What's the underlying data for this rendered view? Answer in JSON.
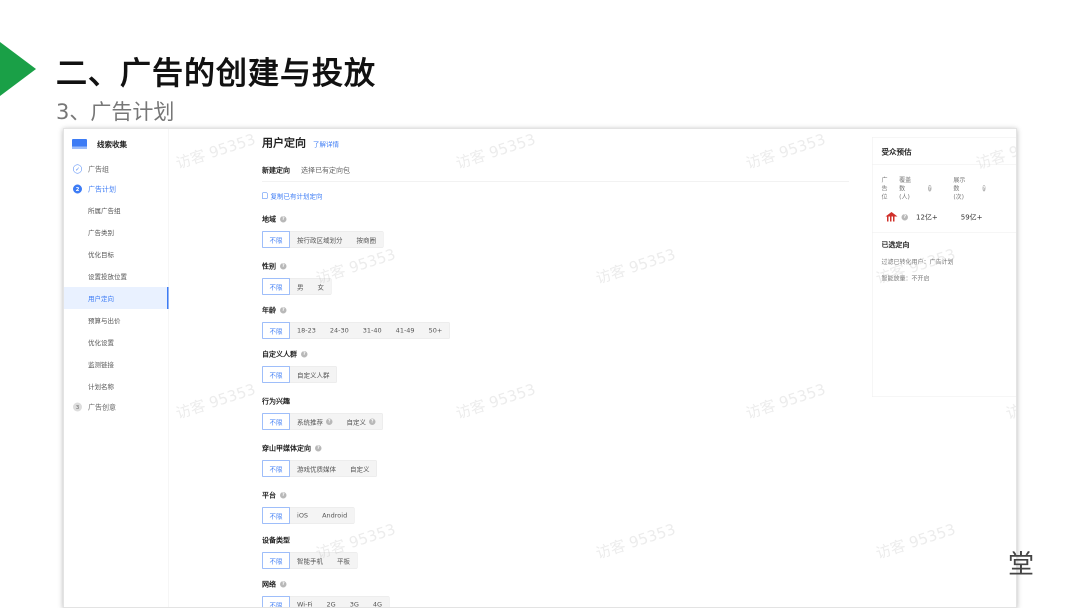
{
  "slide": {
    "title": "二、广告的创建与投放",
    "subtitle": "3、广告计划",
    "corner_mark": "堂"
  },
  "colors": {
    "accent": "#3d7cf5",
    "arrow": "#1aa047",
    "badge": "#d0302a"
  },
  "sidebar": {
    "header": "线索收集",
    "steps": [
      {
        "num": "✓",
        "label": "广告组"
      },
      {
        "num": "2",
        "label": "广告计划"
      },
      {
        "num": "3",
        "label": "广告创意"
      }
    ],
    "items": [
      "所属广告组",
      "广告类别",
      "优化目标",
      "设置投放位置",
      "用户定向",
      "预算与出价",
      "优化设置",
      "监测链接",
      "计划名称"
    ],
    "selected_item": "用户定向"
  },
  "main": {
    "title": "用户定向",
    "learn_link": "了解详情",
    "tabs": [
      "新建定向",
      "选择已有定向包"
    ],
    "copy_link": "复制已有计划定向",
    "fields": [
      {
        "label": "地域",
        "help": true,
        "options": [
          "不限",
          "按行政区域划分",
          "按商圈"
        ]
      },
      {
        "label": "性别",
        "help": true,
        "options": [
          "不限",
          "男",
          "女"
        ]
      },
      {
        "label": "年龄",
        "help": true,
        "options": [
          "不限",
          "18-23",
          "24-30",
          "31-40",
          "41-49",
          "50+"
        ]
      },
      {
        "label": "自定义人群",
        "help": true,
        "options": [
          "不限",
          "自定义人群"
        ]
      },
      {
        "label": "行为兴趣",
        "help": false,
        "options": [
          "不限",
          "系统推荐",
          "自定义"
        ]
      },
      {
        "label": "穿山甲媒体定向",
        "help": true,
        "options": [
          "不限",
          "游戏优质媒体",
          "自定义"
        ]
      },
      {
        "label": "平台",
        "help": true,
        "options": [
          "不限",
          "iOS",
          "Android"
        ]
      },
      {
        "label": "设备类型",
        "help": false,
        "options": [
          "不限",
          "智能手机",
          "平板"
        ]
      },
      {
        "label": "网络",
        "help": true,
        "options": [
          "不限",
          "Wi-Fi",
          "2G",
          "3G",
          "4G"
        ]
      }
    ]
  },
  "panel": {
    "title": "受众预估",
    "columns": [
      "广告位",
      "覆盖数(人)",
      "展示数(次)"
    ],
    "placement_icon": "toutiao-roof-icon",
    "coverage": "12亿+",
    "impressions": "59亿+",
    "selected_title": "已选定向",
    "info": [
      {
        "key": "过滤已转化用户：",
        "value": "广告计划"
      },
      {
        "key": "智能放量：",
        "value": "不开启"
      }
    ]
  },
  "watermark": "访客 95353"
}
